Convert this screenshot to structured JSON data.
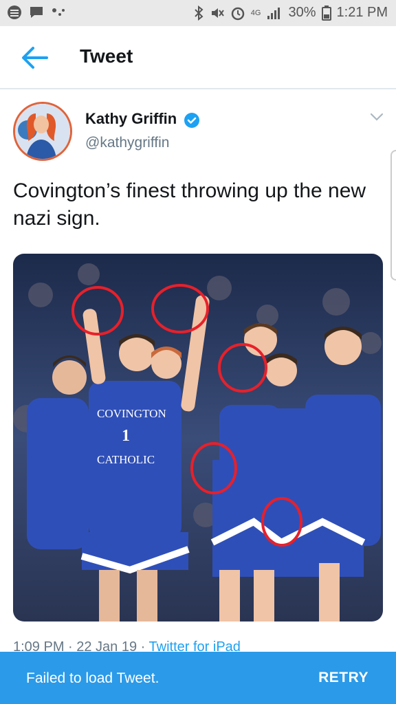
{
  "status_bar": {
    "battery": "30%",
    "time": "1:21 PM",
    "network": "4G"
  },
  "app_bar": {
    "title": "Tweet"
  },
  "tweet": {
    "author_name": "Kathy Griffin",
    "handle": "@kathygriffin",
    "text": "Covington’s finest throwing up the new nazi sign.",
    "timestamp": "1:09 PM · 22 Jan 19 · ",
    "source": "Twitter for iPad",
    "jersey_top": "COVINGTON",
    "jersey_number": "1",
    "jersey_bottom": "CATHOLIC"
  },
  "snackbar": {
    "message": "Failed to load Tweet.",
    "action": "RETRY"
  },
  "colors": {
    "accent": "#1da1f2",
    "snackbar": "#2b9ae8",
    "circle_annotation": "#e8202a"
  }
}
